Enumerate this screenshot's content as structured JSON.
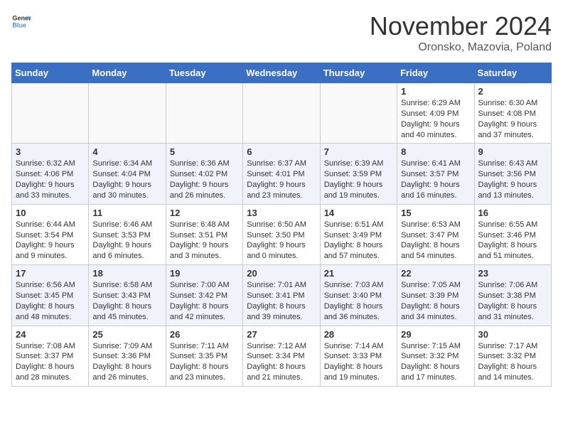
{
  "header": {
    "logo_line1": "General",
    "logo_line2": "Blue",
    "month_title": "November 2024",
    "location": "Oronsko, Mazovia, Poland"
  },
  "days_of_week": [
    "Sunday",
    "Monday",
    "Tuesday",
    "Wednesday",
    "Thursday",
    "Friday",
    "Saturday"
  ],
  "weeks": [
    {
      "days": [
        {
          "num": "",
          "content": ""
        },
        {
          "num": "",
          "content": ""
        },
        {
          "num": "",
          "content": ""
        },
        {
          "num": "",
          "content": ""
        },
        {
          "num": "",
          "content": ""
        },
        {
          "num": "1",
          "content": "Sunrise: 6:29 AM\nSunset: 4:09 PM\nDaylight: 9 hours and 40 minutes."
        },
        {
          "num": "2",
          "content": "Sunrise: 6:30 AM\nSunset: 4:08 PM\nDaylight: 9 hours and 37 minutes."
        }
      ]
    },
    {
      "days": [
        {
          "num": "3",
          "content": "Sunrise: 6:32 AM\nSunset: 4:06 PM\nDaylight: 9 hours and 33 minutes."
        },
        {
          "num": "4",
          "content": "Sunrise: 6:34 AM\nSunset: 4:04 PM\nDaylight: 9 hours and 30 minutes."
        },
        {
          "num": "5",
          "content": "Sunrise: 6:36 AM\nSunset: 4:02 PM\nDaylight: 9 hours and 26 minutes."
        },
        {
          "num": "6",
          "content": "Sunrise: 6:37 AM\nSunset: 4:01 PM\nDaylight: 9 hours and 23 minutes."
        },
        {
          "num": "7",
          "content": "Sunrise: 6:39 AM\nSunset: 3:59 PM\nDaylight: 9 hours and 19 minutes."
        },
        {
          "num": "8",
          "content": "Sunrise: 6:41 AM\nSunset: 3:57 PM\nDaylight: 9 hours and 16 minutes."
        },
        {
          "num": "9",
          "content": "Sunrise: 6:43 AM\nSunset: 3:56 PM\nDaylight: 9 hours and 13 minutes."
        }
      ]
    },
    {
      "days": [
        {
          "num": "10",
          "content": "Sunrise: 6:44 AM\nSunset: 3:54 PM\nDaylight: 9 hours and 9 minutes."
        },
        {
          "num": "11",
          "content": "Sunrise: 6:46 AM\nSunset: 3:53 PM\nDaylight: 9 hours and 6 minutes."
        },
        {
          "num": "12",
          "content": "Sunrise: 6:48 AM\nSunset: 3:51 PM\nDaylight: 9 hours and 3 minutes."
        },
        {
          "num": "13",
          "content": "Sunrise: 6:50 AM\nSunset: 3:50 PM\nDaylight: 9 hours and 0 minutes."
        },
        {
          "num": "14",
          "content": "Sunrise: 6:51 AM\nSunset: 3:49 PM\nDaylight: 8 hours and 57 minutes."
        },
        {
          "num": "15",
          "content": "Sunrise: 6:53 AM\nSunset: 3:47 PM\nDaylight: 8 hours and 54 minutes."
        },
        {
          "num": "16",
          "content": "Sunrise: 6:55 AM\nSunset: 3:46 PM\nDaylight: 8 hours and 51 minutes."
        }
      ]
    },
    {
      "days": [
        {
          "num": "17",
          "content": "Sunrise: 6:56 AM\nSunset: 3:45 PM\nDaylight: 8 hours and 48 minutes."
        },
        {
          "num": "18",
          "content": "Sunrise: 6:58 AM\nSunset: 3:43 PM\nDaylight: 8 hours and 45 minutes."
        },
        {
          "num": "19",
          "content": "Sunrise: 7:00 AM\nSunset: 3:42 PM\nDaylight: 8 hours and 42 minutes."
        },
        {
          "num": "20",
          "content": "Sunrise: 7:01 AM\nSunset: 3:41 PM\nDaylight: 8 hours and 39 minutes."
        },
        {
          "num": "21",
          "content": "Sunrise: 7:03 AM\nSunset: 3:40 PM\nDaylight: 8 hours and 36 minutes."
        },
        {
          "num": "22",
          "content": "Sunrise: 7:05 AM\nSunset: 3:39 PM\nDaylight: 8 hours and 34 minutes."
        },
        {
          "num": "23",
          "content": "Sunrise: 7:06 AM\nSunset: 3:38 PM\nDaylight: 8 hours and 31 minutes."
        }
      ]
    },
    {
      "days": [
        {
          "num": "24",
          "content": "Sunrise: 7:08 AM\nSunset: 3:37 PM\nDaylight: 8 hours and 28 minutes."
        },
        {
          "num": "25",
          "content": "Sunrise: 7:09 AM\nSunset: 3:36 PM\nDaylight: 8 hours and 26 minutes."
        },
        {
          "num": "26",
          "content": "Sunrise: 7:11 AM\nSunset: 3:35 PM\nDaylight: 8 hours and 23 minutes."
        },
        {
          "num": "27",
          "content": "Sunrise: 7:12 AM\nSunset: 3:34 PM\nDaylight: 8 hours and 21 minutes."
        },
        {
          "num": "28",
          "content": "Sunrise: 7:14 AM\nSunset: 3:33 PM\nDaylight: 8 hours and 19 minutes."
        },
        {
          "num": "29",
          "content": "Sunrise: 7:15 AM\nSunset: 3:32 PM\nDaylight: 8 hours and 17 minutes."
        },
        {
          "num": "30",
          "content": "Sunrise: 7:17 AM\nSunset: 3:32 PM\nDaylight: 8 hours and 14 minutes."
        }
      ]
    }
  ]
}
